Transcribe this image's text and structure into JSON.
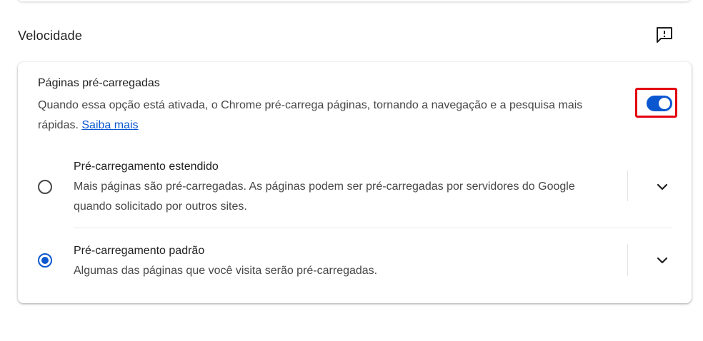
{
  "section": {
    "title": "Velocidade",
    "feedback_icon": "feedback-icon"
  },
  "preload": {
    "title": "Páginas pré-carregadas",
    "description": "Quando essa opção está ativada, o Chrome pré-carrega páginas, tornando a navegação e a pesquisa mais rápidas.",
    "link": "Saiba mais",
    "toggle_on": true
  },
  "options": [
    {
      "title": "Pré-carregamento estendido",
      "description": "Mais páginas são pré-carregadas. As páginas podem ser pré-carregadas por servidores do Google quando solicitado por outros sites.",
      "selected": false
    },
    {
      "title": "Pré-carregamento padrão",
      "description": "Algumas das páginas que você visita serão pré-carregadas.",
      "selected": true
    }
  ],
  "colors": {
    "accent": "#0b57d0",
    "highlight": "#e3000f"
  }
}
